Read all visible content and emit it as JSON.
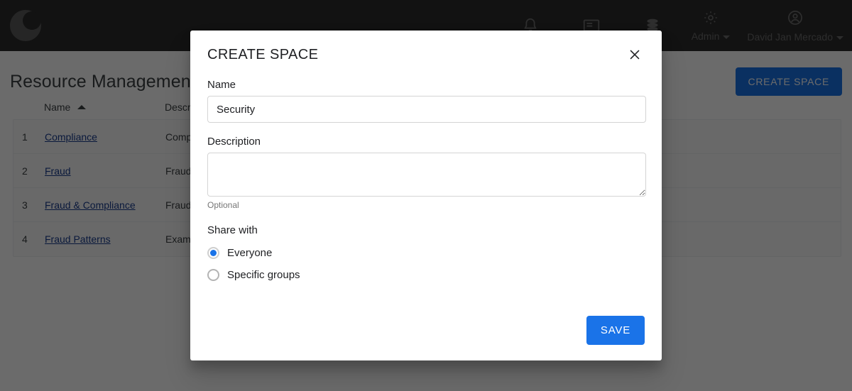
{
  "topnav": {
    "logo_icon": "eclipse-logo-icon",
    "icons": [
      {
        "name": "notifications-icon",
        "label": "Notifications"
      },
      {
        "name": "news-icon",
        "label": "News"
      },
      {
        "name": "database-icon",
        "label": "Data"
      }
    ],
    "admin": {
      "icon": "gear-icon",
      "label": "Admin"
    },
    "user": {
      "icon": "account-circle-icon",
      "label": "David Jan Mercado"
    }
  },
  "page": {
    "title": "Resource Management",
    "create_space_label": "CREATE SPACE",
    "table": {
      "columns": [
        "",
        "Name",
        "Description"
      ],
      "sort_column": "Name",
      "sort_direction": "ascending",
      "rows": [
        {
          "index": "1",
          "name": "Compliance",
          "description": "Compliance"
        },
        {
          "index": "2",
          "name": "Fraud",
          "description": "Fraud s"
        },
        {
          "index": "3",
          "name": "Fraud & Compliance",
          "description": "Fraud a"
        },
        {
          "index": "4",
          "name": "Fraud Patterns",
          "description": "Example"
        }
      ]
    }
  },
  "modal": {
    "title": "CREATE SPACE",
    "close_icon": "close-icon",
    "name": {
      "label": "Name",
      "value": "Security",
      "placeholder": ""
    },
    "description": {
      "label": "Description",
      "value": "",
      "placeholder": "",
      "helper": "Optional"
    },
    "share": {
      "label": "Share with",
      "options": [
        {
          "label": "Everyone",
          "selected": true
        },
        {
          "label": "Specific groups",
          "selected": false
        }
      ]
    },
    "save_label": "SAVE"
  },
  "colors": {
    "accent_blue": "#1a73e8",
    "nav_background": "#2b2b2b",
    "scrim": "rgba(0,0,0,0.58)",
    "link": "#1a3d8f"
  }
}
